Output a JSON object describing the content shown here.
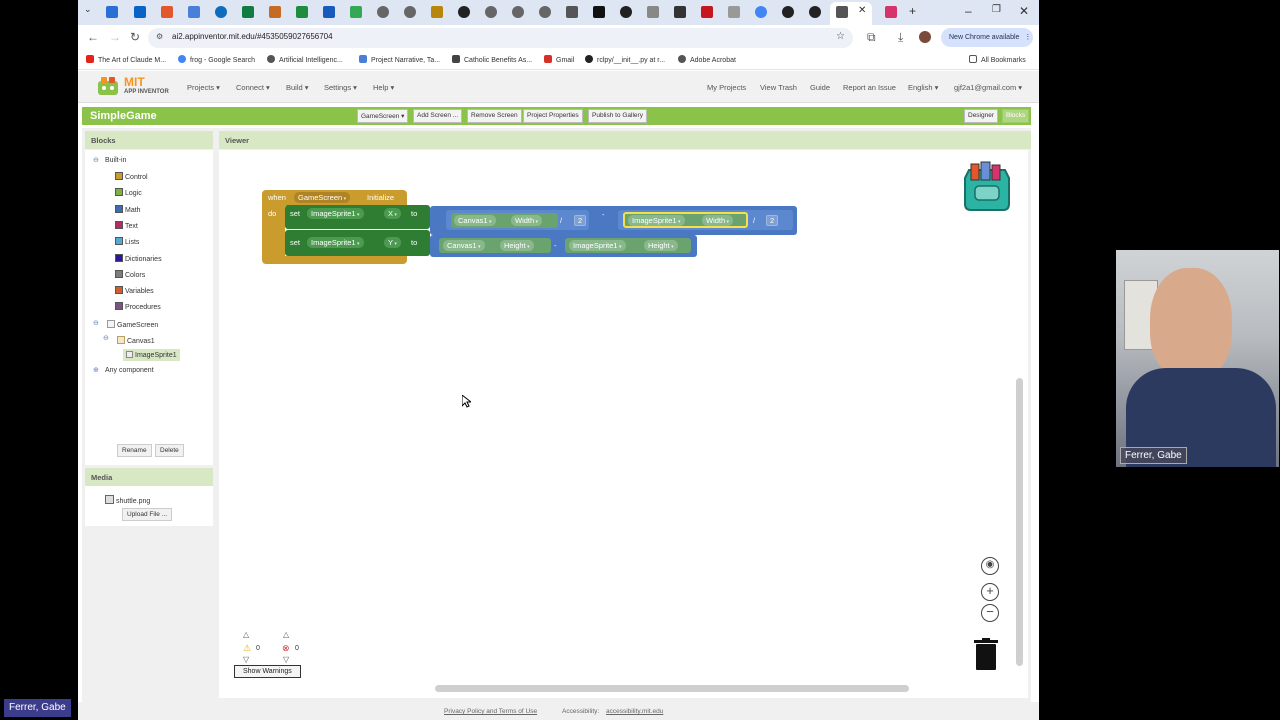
{
  "browser": {
    "url": "ai2.appinventor.mit.edu/#4535059027656704",
    "update_button": "New Chrome available",
    "bookmarks": [
      "The Art of Claude M...",
      "frog - Google Search",
      "Artificial Intelligenc...",
      "Project Narrative, Ta...",
      "Catholic Benefits As...",
      "Gmail",
      "rclpy/__init__.py at r...",
      "Adobe Acrobat"
    ],
    "all_bookmarks": "All Bookmarks"
  },
  "app": {
    "logo_mit": "MIT",
    "logo_sub": "APP INVENTOR",
    "menus": [
      "Projects ▾",
      "Connect ▾",
      "Build ▾",
      "Settings ▾",
      "Help ▾"
    ],
    "right_menus": [
      "My Projects",
      "View Trash",
      "Guide",
      "Report an Issue",
      "English ▾",
      "gjf2a1@gmail.com ▾"
    ]
  },
  "toolbar": {
    "project_name": "SimpleGame",
    "screen_select": "GameScreen ▾",
    "add_screen": "Add Screen ...",
    "remove_screen": "Remove Screen",
    "project_properties": "Project Properties",
    "publish": "Publish to Gallery",
    "designer": "Designer",
    "blocks": "Blocks"
  },
  "blocks_panel": {
    "title": "Blocks",
    "built_in": "Built-in",
    "categories": [
      {
        "label": "Control",
        "color": "#c99c2d"
      },
      {
        "label": "Logic",
        "color": "#7fb142"
      },
      {
        "label": "Math",
        "color": "#3f6bb5"
      },
      {
        "label": "Text",
        "color": "#b32d5e"
      },
      {
        "label": "Lists",
        "color": "#52a9d4"
      },
      {
        "label": "Dictionaries",
        "color": "#2d1799"
      },
      {
        "label": "Colors",
        "color": "#7d7d7d"
      },
      {
        "label": "Variables",
        "color": "#d05f2d"
      },
      {
        "label": "Procedures",
        "color": "#7c5385"
      }
    ],
    "screen": "GameScreen",
    "canvas": "Canvas1",
    "sprite": "ImageSprite1",
    "any_component": "Any component",
    "rename": "Rename",
    "delete": "Delete"
  },
  "media": {
    "title": "Media",
    "file": "shuttle.png",
    "upload": "Upload File ..."
  },
  "viewer": {
    "title": "Viewer",
    "event": {
      "when": "when",
      "component": "GameScreen",
      "event": "Initialize",
      "do": "do"
    },
    "stmt1": {
      "set": "set",
      "component": "ImageSprite1",
      "prop": "X",
      "to": "to",
      "a_comp": "Canvas1",
      "a_prop": "Width",
      "div1": "/",
      "n1": "2",
      "minus": "-",
      "b_comp": "ImageSprite1",
      "b_prop": "Width",
      "div2": "/",
      "n2": "2"
    },
    "stmt2": {
      "set": "set",
      "component": "ImageSprite1",
      "prop": "Y",
      "to": "to",
      "a_comp": "Canvas1",
      "a_prop": "Height",
      "minus": "-",
      "b_comp": "ImageSprite1",
      "b_prop": "Height"
    },
    "warnings_count": "0",
    "errors_count": "0",
    "show_warnings": "Show Warnings"
  },
  "footer": {
    "privacy": "Privacy Policy and Terms of Use",
    "accessibility_label": "Accessibility:",
    "accessibility_link": "accessibility.mit.edu"
  },
  "video": {
    "presenter": "Ferrer, Gabe",
    "self_label": "Ferrer, Gabe"
  }
}
